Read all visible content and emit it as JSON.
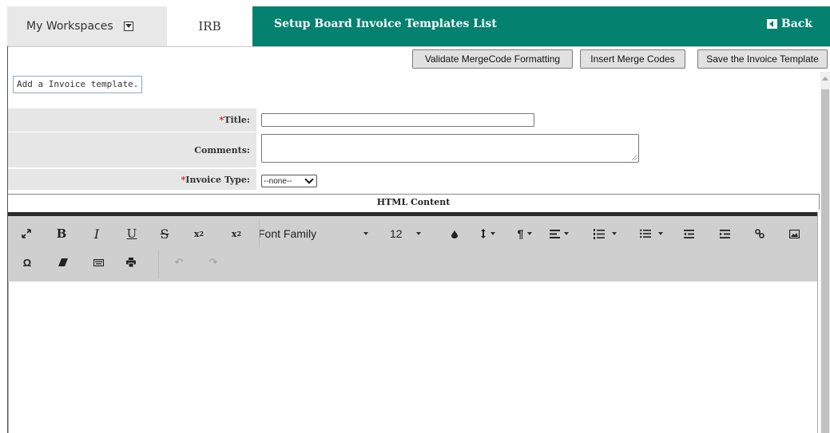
{
  "nav": {
    "workspace_label": "My Workspaces",
    "irb_label": "IRB",
    "page_title": "Setup Board Invoice Templates List",
    "back_label": "Back"
  },
  "actions": {
    "validate": "Validate MergeCode Formatting",
    "insert": "Insert Merge Codes",
    "save": "Save the Invoice Template"
  },
  "hint": "Add a Invoice template.",
  "form": {
    "title_required": "*",
    "title_label": "Title:",
    "title_value": "",
    "comments_label": "Comments:",
    "comments_value": "",
    "invoice_type_required": "*",
    "invoice_type_label": "Invoice Type:",
    "invoice_type_selected": "--none--"
  },
  "editor": {
    "section_label": "HTML Content",
    "font_family": "Font Family",
    "font_size": "12",
    "toolbar_row1": [
      "fullscreen-icon",
      "bold-icon",
      "italic-icon",
      "underline-icon",
      "strikethrough-icon",
      "subscript-icon",
      "superscript-icon",
      "font-family-select",
      "font-size-select",
      "color-icon",
      "line-height-icon",
      "paragraph-format-icon",
      "align-icon",
      "ordered-list-icon",
      "unordered-list-icon",
      "outdent-icon",
      "indent-icon",
      "link-icon",
      "image-icon"
    ],
    "toolbar_row2": [
      "special-characters-icon",
      "clear-formatting-icon",
      "keyboard-icon",
      "print-icon",
      "undo-icon",
      "redo-icon"
    ]
  },
  "colors": {
    "header_teal": "#04816f",
    "tab_gray": "#e8e8e8",
    "label_gray": "#e6e6e6",
    "toolbar_gray": "#cfcfcf",
    "required_red": "#e02424"
  }
}
